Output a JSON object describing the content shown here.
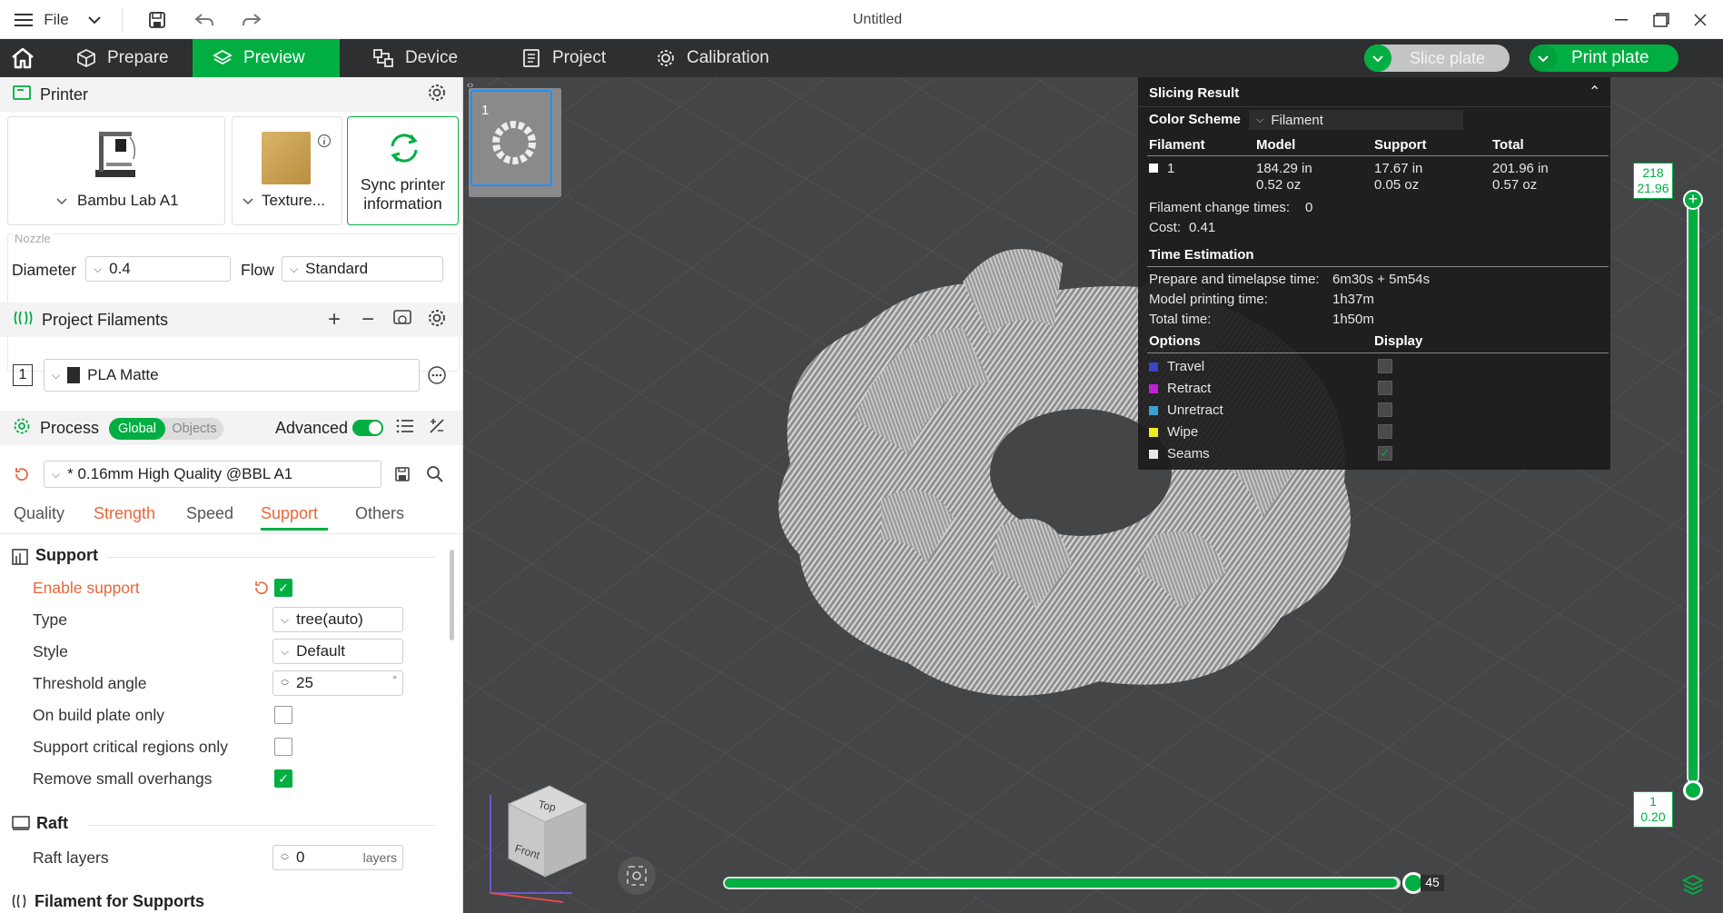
{
  "window": {
    "title": "Untitled",
    "menu_label": "File"
  },
  "tabs": [
    {
      "label": "Prepare"
    },
    {
      "label": "Preview"
    },
    {
      "label": "Device"
    },
    {
      "label": "Project"
    },
    {
      "label": "Calibration"
    }
  ],
  "actions": {
    "slice_label": "Slice plate",
    "print_label": "Print plate"
  },
  "printer": {
    "section_label": "Printer",
    "model": "Bambu Lab A1",
    "plate": "Texture...",
    "sync_line1": "Sync printer",
    "sync_line2": "information",
    "nozzle_label": "Nozzle",
    "diameter_label": "Diameter",
    "diameter_value": "0.4",
    "flow_label": "Flow",
    "flow_value": "Standard"
  },
  "filaments": {
    "section_label": "Project Filaments",
    "items": [
      {
        "index": "1",
        "name": "PLA Matte",
        "color": "#2a2a2a"
      }
    ]
  },
  "process": {
    "section_label": "Process",
    "global_label": "Global",
    "objects_label": "Objects",
    "advanced_label": "Advanced",
    "preset": "* 0.16mm High Quality @BBL A1",
    "subtabs": [
      "Quality",
      "Strength",
      "Speed",
      "Support",
      "Others"
    ],
    "support_group": "Support",
    "enable_support": "Enable support",
    "type_label": "Type",
    "type_value": "tree(auto)",
    "style_label": "Style",
    "style_value": "Default",
    "threshold_label": "Threshold angle",
    "threshold_value": "25",
    "threshold_unit": "°",
    "build_plate_only": "On build plate only",
    "critical_regions": "Support critical regions only",
    "remove_overhangs": "Remove small overhangs",
    "raft_group": "Raft",
    "raft_layers_label": "Raft layers",
    "raft_layers_value": "0",
    "raft_layers_unit": "layers",
    "filament_supports_group": "Filament for Supports"
  },
  "plate": {
    "number": "1"
  },
  "slicing": {
    "title": "Slicing Result",
    "color_scheme_label": "Color Scheme",
    "color_scheme_value": "Filament",
    "headers": [
      "Filament",
      "Model",
      "Support",
      "Total"
    ],
    "row": {
      "filament": "1",
      "model_len": "184.29 in",
      "model_wt": "0.52 oz",
      "support_len": "17.67 in",
      "support_wt": "0.05 oz",
      "total_len": "201.96 in",
      "total_wt": "0.57 oz"
    },
    "change_times_label": "Filament change times:",
    "change_times_value": "0",
    "cost_label": "Cost:",
    "cost_value": "0.41",
    "time_title": "Time Estimation",
    "prepare_label": "Prepare and timelapse time:",
    "prepare_value": "6m30s + 5m54s",
    "model_time_label": "Model printing time:",
    "model_time_value": "1h37m",
    "total_time_label": "Total time:",
    "total_time_value": "1h50m",
    "options_label": "Options",
    "display_label": "Display",
    "options": [
      {
        "label": "Travel",
        "color": "#3a46c4"
      },
      {
        "label": "Retract",
        "color": "#c21fd6"
      },
      {
        "label": "Unretract",
        "color": "#3aa1d4"
      },
      {
        "label": "Wipe",
        "color": "#ecec1e"
      },
      {
        "label": "Seams",
        "color": "#e6e6e6"
      }
    ]
  },
  "layer_slider": {
    "top_layer": "218",
    "top_height": "21.96",
    "bottom_layer": "1",
    "bottom_height": "0.20"
  },
  "move_slider": {
    "value": "45"
  },
  "colors": {
    "accent": "#00ae42",
    "orange": "#e8663a",
    "dark_bar": "#2d2f30",
    "viewport": "#444546"
  }
}
